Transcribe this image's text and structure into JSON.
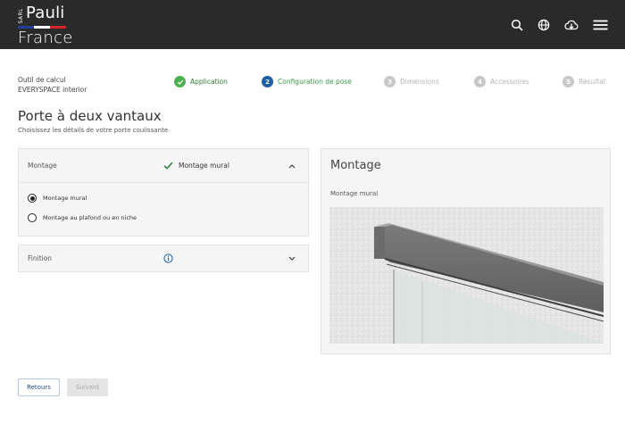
{
  "brand": {
    "sarl": "SARL",
    "name_top": "Pauli",
    "name_bottom": "France",
    "flag_colors": [
      "#1f3f9a",
      "#ffffff",
      "#d8262f"
    ]
  },
  "header_icons": [
    "search-icon",
    "globe-icon",
    "cloud-download-icon",
    "menu-icon"
  ],
  "calculator": {
    "line1": "Outil de calcul",
    "line2": "EVERYSPACE interior"
  },
  "steps": [
    {
      "num": "✓",
      "label": "Application",
      "state": "done"
    },
    {
      "num": "2",
      "label": "Configuration de pose",
      "state": "active"
    },
    {
      "num": "3",
      "label": "Dimensions",
      "state": "pending"
    },
    {
      "num": "4",
      "label": "Accessoires",
      "state": "pending"
    },
    {
      "num": "5",
      "label": "Résultat",
      "state": "pending"
    }
  ],
  "page": {
    "title": "Porte à deux vantaux",
    "subtitle": "Choisissez les détails de votre porte coulissante"
  },
  "montage": {
    "label": "Montage",
    "selected": "Montage mural",
    "options": [
      "Montage mural",
      "Montage au plafond ou en niche"
    ],
    "selected_index": 0
  },
  "finition": {
    "label": "Finition"
  },
  "preview": {
    "title": "Montage",
    "subtitle": "Montage mural"
  },
  "buttons": {
    "back": "Retours",
    "next": "Suivant"
  },
  "colors": {
    "accent_green": "#4caf50",
    "accent_blue": "#1d5ea8",
    "step_pending": "#c8c8c8",
    "topbar": "#2a2a2a"
  }
}
